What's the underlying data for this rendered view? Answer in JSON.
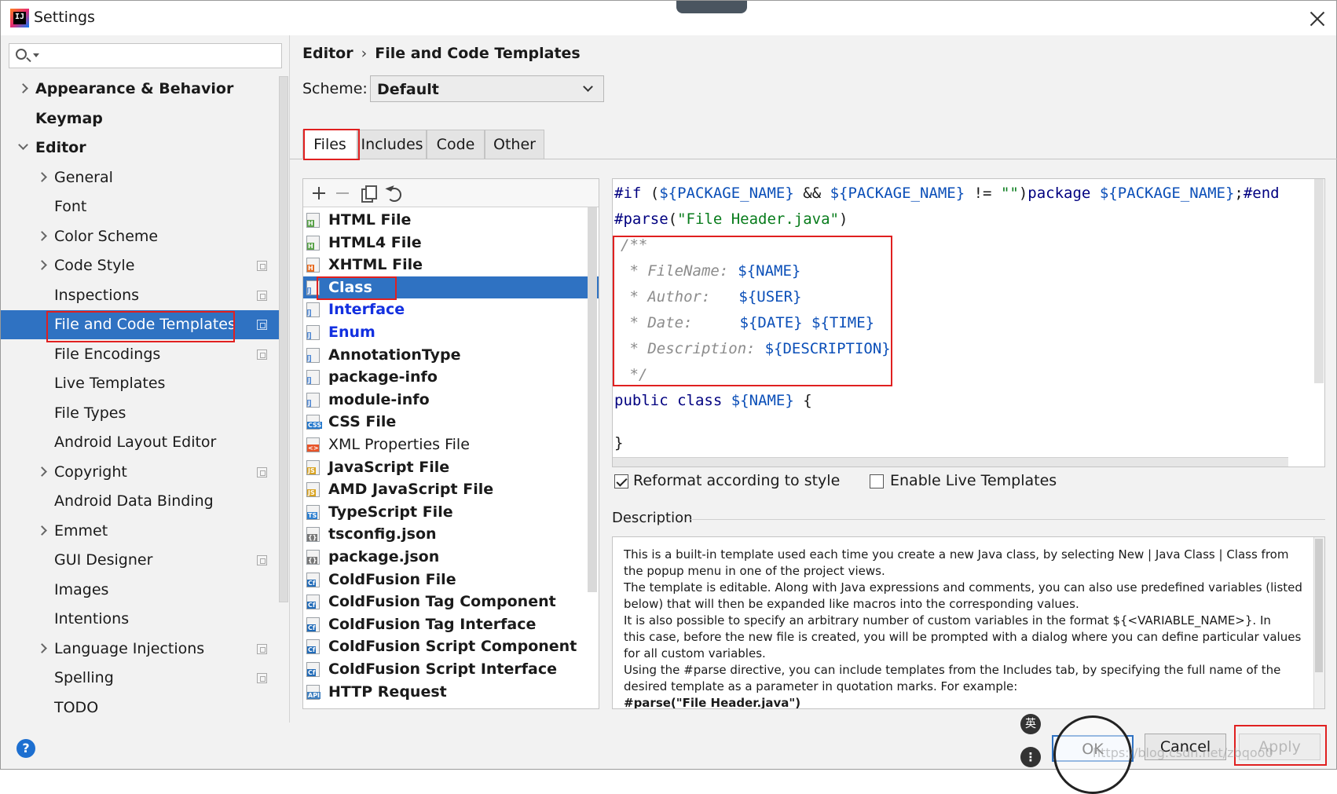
{
  "window": {
    "title": "Settings",
    "icon_letters": "IJ"
  },
  "search": {
    "placeholder": ""
  },
  "sidebar": {
    "items": [
      {
        "label": "Appearance & Behavior",
        "expandable": true,
        "expanded": false,
        "bold": true,
        "indent": 0,
        "has_page_icon": false
      },
      {
        "label": "Keymap",
        "expandable": false,
        "bold": true,
        "indent": 0,
        "has_page_icon": false
      },
      {
        "label": "Editor",
        "expandable": true,
        "expanded": true,
        "bold": true,
        "indent": 0,
        "has_page_icon": false
      },
      {
        "label": "General",
        "expandable": true,
        "expanded": false,
        "indent": 1,
        "has_page_icon": false
      },
      {
        "label": "Font",
        "expandable": false,
        "indent": 1,
        "has_page_icon": false
      },
      {
        "label": "Color Scheme",
        "expandable": true,
        "expanded": false,
        "indent": 1,
        "has_page_icon": false
      },
      {
        "label": "Code Style",
        "expandable": true,
        "expanded": false,
        "indent": 1,
        "has_page_icon": true
      },
      {
        "label": "Inspections",
        "expandable": false,
        "indent": 1,
        "has_page_icon": true
      },
      {
        "label": "File and Code Templates",
        "expandable": false,
        "indent": 1,
        "has_page_icon": true,
        "selected": true
      },
      {
        "label": "File Encodings",
        "expandable": false,
        "indent": 1,
        "has_page_icon": true
      },
      {
        "label": "Live Templates",
        "expandable": false,
        "indent": 1,
        "has_page_icon": false
      },
      {
        "label": "File Types",
        "expandable": false,
        "indent": 1,
        "has_page_icon": false
      },
      {
        "label": "Android Layout Editor",
        "expandable": false,
        "indent": 1,
        "has_page_icon": false
      },
      {
        "label": "Copyright",
        "expandable": true,
        "expanded": false,
        "indent": 1,
        "has_page_icon": true
      },
      {
        "label": "Android Data Binding",
        "expandable": false,
        "indent": 1,
        "has_page_icon": false
      },
      {
        "label": "Emmet",
        "expandable": true,
        "expanded": false,
        "indent": 1,
        "has_page_icon": false
      },
      {
        "label": "GUI Designer",
        "expandable": false,
        "indent": 1,
        "has_page_icon": true
      },
      {
        "label": "Images",
        "expandable": false,
        "indent": 1,
        "has_page_icon": false
      },
      {
        "label": "Intentions",
        "expandable": false,
        "indent": 1,
        "has_page_icon": false
      },
      {
        "label": "Language Injections",
        "expandable": true,
        "expanded": false,
        "indent": 1,
        "has_page_icon": true
      },
      {
        "label": "Spelling",
        "expandable": false,
        "indent": 1,
        "has_page_icon": true
      },
      {
        "label": "TODO",
        "expandable": false,
        "indent": 1,
        "has_page_icon": false
      }
    ]
  },
  "breadcrumb": {
    "parent": "Editor",
    "separator": "›",
    "current": "File and Code Templates"
  },
  "scheme": {
    "label": "Scheme:",
    "value": "Default"
  },
  "tabs": [
    {
      "label": "Files",
      "active": true
    },
    {
      "label": "Includes",
      "active": false
    },
    {
      "label": "Code",
      "active": false
    },
    {
      "label": "Other",
      "active": false
    }
  ],
  "templates": [
    {
      "label": "HTML File",
      "icon": "html-file-icon",
      "badge": "H"
    },
    {
      "label": "HTML4 File",
      "icon": "html-file-icon",
      "badge": "H"
    },
    {
      "label": "XHTML File",
      "icon": "xhtml-file-icon",
      "badge": "H"
    },
    {
      "label": "Class",
      "icon": "java-class-icon",
      "badge": "J",
      "selected": true
    },
    {
      "label": "Interface",
      "icon": "java-interface-icon",
      "badge": "J",
      "blue": true
    },
    {
      "label": "Enum",
      "icon": "java-enum-icon",
      "badge": "J",
      "blue": true
    },
    {
      "label": "AnnotationType",
      "icon": "java-annotation-icon",
      "badge": "J"
    },
    {
      "label": "package-info",
      "icon": "java-file-icon",
      "badge": "J"
    },
    {
      "label": "module-info",
      "icon": "java-file-icon",
      "badge": "J"
    },
    {
      "label": "CSS File",
      "icon": "css-file-icon",
      "badge": "CSS"
    },
    {
      "label": "XML Properties File",
      "icon": "xml-file-icon",
      "badge": "<>",
      "normal": true
    },
    {
      "label": "JavaScript File",
      "icon": "js-file-icon",
      "badge": "JS"
    },
    {
      "label": "AMD JavaScript File",
      "icon": "js-file-icon",
      "badge": "JS"
    },
    {
      "label": "TypeScript File",
      "icon": "ts-file-icon",
      "badge": "TS"
    },
    {
      "label": "tsconfig.json",
      "icon": "json-file-icon",
      "badge": "{}"
    },
    {
      "label": "package.json",
      "icon": "json-file-icon",
      "badge": "{}"
    },
    {
      "label": "ColdFusion File",
      "icon": "coldfusion-icon",
      "badge": "Cf"
    },
    {
      "label": "ColdFusion Tag Component",
      "icon": "coldfusion-icon",
      "badge": "Cf"
    },
    {
      "label": "ColdFusion Tag Interface",
      "icon": "coldfusion-icon",
      "badge": "Cf"
    },
    {
      "label": "ColdFusion Script Component",
      "icon": "coldfusion-icon",
      "badge": "Cf"
    },
    {
      "label": "ColdFusion Script Interface",
      "icon": "coldfusion-icon",
      "badge": "Cf"
    },
    {
      "label": "HTTP Request",
      "icon": "http-request-icon",
      "badge": "API"
    }
  ],
  "editor": {
    "line1": {
      "kw1": "#if",
      "a": " (",
      "v1": "${PACKAGE_NAME}",
      "b": " && ",
      "v2": "${PACKAGE_NAME}",
      "c": " != ",
      "s": "\"\"",
      "d": ")",
      "kw2": "package",
      "e": " ",
      "v3": "${PACKAGE_NAME}",
      "f": ";",
      "kw3": "#end"
    },
    "line2": {
      "kw": "#parse",
      "a": "(",
      "s": "\"File Header.java\"",
      "b": ")"
    },
    "c1": "/**",
    "c2": " * FileName:",
    "c2v": "${NAME}",
    "c3": " * Author:",
    "c3v": "${USER}",
    "c4": " * Date:",
    "c4v1": "${DATE}",
    "c4v2": "${TIME}",
    "c5": " * Description:",
    "c5v": "${DESCRIPTION}",
    "c6": " */",
    "decl_kw": "public class",
    "decl_var": "${NAME}",
    "decl_brace": " {",
    "close": "}"
  },
  "options": {
    "reformat_label": "Reformat according to style",
    "reformat_checked": true,
    "live_label": "Enable Live Templates",
    "live_checked": false
  },
  "description": {
    "title": "Description",
    "lines": [
      "This is a built-in template used each time you create a new Java class, by selecting New | Java Class | Class from",
      "the popup menu in one of the project views.",
      "The template is editable. Along with Java expressions and comments, you can also use predefined variables (listed",
      "below) that will then be expanded like macros into the corresponding values.",
      "It is also possible to specify an arbitrary number of custom variables in the format ${<VARIABLE_NAME>}. In",
      "this case, before the new file is created, you will be prompted with a dialog where you can define particular values",
      "for all custom variables.",
      "Using the #parse directive, you can include templates from the Includes tab, by specifying the full name of the",
      "desired template as a parameter in quotation marks. For example:",
      "#parse(\"File Header.java\")"
    ]
  },
  "buttons": {
    "ok": "OK",
    "cancel": "Cancel",
    "apply": "Apply",
    "help": "?"
  },
  "ime": {
    "lang": "英",
    "extra": "⋮"
  },
  "watermark": "https://blog.csdn.net/zbqoo0"
}
